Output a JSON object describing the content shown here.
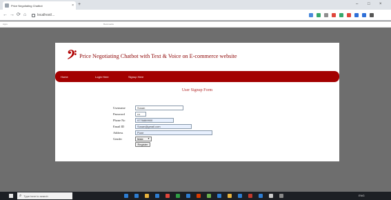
{
  "browser": {
    "tab_title": "Price Negotiating Chatbot",
    "tab_close": "×",
    "new_tab": "+",
    "window_controls": [
      "–",
      "□",
      "×"
    ],
    "nav": {
      "back": "←",
      "forward": "→",
      "reload": "⟳",
      "home": "⌂"
    },
    "url": "localhost/...",
    "extension_colors": [
      "#4a89dc",
      "#37a86b",
      "#8e8e8e",
      "#e0463b",
      "#37a86b",
      "#e0463b",
      "#2e6fd8",
      "#2e6fd8",
      "#555555"
    ],
    "bookmarks": [
      "Apps",
      "Bookmarks"
    ]
  },
  "site": {
    "logo_glyph": "𝄢",
    "title": "Price Negotiating Chatbot with Text & Voice on E-commerce website",
    "nav_links": [
      "Home",
      "Login Here",
      "Signup Here"
    ],
    "page_heading": "User Signup Form",
    "form": {
      "fields": [
        {
          "label": "Username",
          "value": "Susan",
          "width": 70,
          "filled": false
        },
        {
          "label": "Password",
          "value": "•••",
          "width": 16,
          "filled": false
        },
        {
          "label": "Phone No",
          "value": "9776889900",
          "width": 56,
          "filled": true
        },
        {
          "label": "Email ID",
          "value": "Susan@gmail.com",
          "width": 82,
          "filled": true
        },
        {
          "label": "Address",
          "value": "Pune",
          "width": 112,
          "filled": true
        }
      ],
      "gender_label": "Gender",
      "gender_value": "Male",
      "submit_label": "Register"
    }
  },
  "taskbar": {
    "search_placeholder": "Type here to search",
    "search_glyph": "⌕",
    "icon_colors": [
      "#2d7dd2",
      "#2d7dd2",
      "#e8b23c",
      "#2d7dd2",
      "#e0463b",
      "#2e9e44",
      "#2d7dd2",
      "#d83b01",
      "#6ab04c",
      "#2d7dd2",
      "#e8b23c",
      "#2d7dd2",
      "#c0392b",
      "#2d7dd2",
      "#cccccc",
      "#888888"
    ],
    "tray_text": "ENG"
  }
}
